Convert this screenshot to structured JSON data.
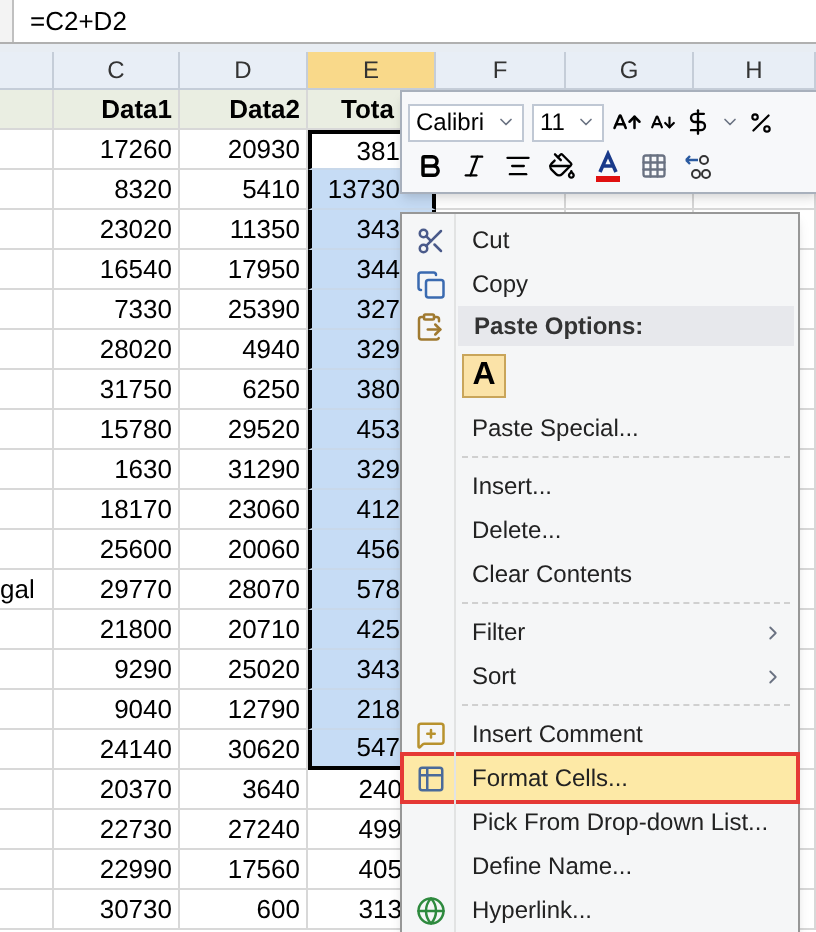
{
  "formula_bar": {
    "value": "=C2+D2"
  },
  "columns": [
    {
      "label": "C",
      "selected": false
    },
    {
      "label": "D",
      "selected": false
    },
    {
      "label": "E",
      "selected": true
    },
    {
      "label": "F",
      "selected": false
    },
    {
      "label": "G",
      "selected": false
    },
    {
      "label": "H",
      "selected": false
    }
  ],
  "header_row": {
    "column_c": "Data1",
    "column_d": "Data2",
    "column_e": "Tota"
  },
  "rows": [
    {
      "column_c": "17260",
      "column_d": "20930",
      "column_e": "381",
      "selected": true,
      "active": true
    },
    {
      "column_c": "8320",
      "column_d": "5410",
      "column_e": "13730",
      "selected": true
    },
    {
      "column_c": "23020",
      "column_d": "11350",
      "column_e": "343",
      "selected": true
    },
    {
      "column_c": "16540",
      "column_d": "17950",
      "column_e": "344",
      "selected": true
    },
    {
      "column_c": "7330",
      "column_d": "25390",
      "column_e": "327",
      "selected": true
    },
    {
      "column_c": "28020",
      "column_d": "4940",
      "column_e": "329",
      "selected": true
    },
    {
      "column_c": "31750",
      "column_d": "6250",
      "column_e": "380",
      "selected": true
    },
    {
      "column_c": "15780",
      "column_d": "29520",
      "column_e": "453",
      "selected": true
    },
    {
      "column_c": "1630",
      "column_d": "31290",
      "column_e": "329",
      "selected": true
    },
    {
      "column_c": "18170",
      "column_d": "23060",
      "column_e": "412",
      "selected": true
    },
    {
      "column_c": "25600",
      "column_d": "20060",
      "column_e": "456",
      "selected": true
    },
    {
      "column_b": "gal",
      "column_c": "29770",
      "column_d": "28070",
      "column_e": "578",
      "selected": true
    },
    {
      "column_c": "21800",
      "column_d": "20710",
      "column_e": "425",
      "selected": true
    },
    {
      "column_c": "9290",
      "column_d": "25020",
      "column_e": "343",
      "selected": true
    },
    {
      "column_c": "9040",
      "column_d": "12790",
      "column_e": "218",
      "selected": true
    },
    {
      "column_c": "24140",
      "column_d": "30620",
      "column_e": "547",
      "selected": true
    },
    {
      "column_c": "20370",
      "column_d": "3640",
      "column_e": "240",
      "selected": false
    },
    {
      "column_c": "22730",
      "column_d": "27240",
      "column_e": "499",
      "selected": false
    },
    {
      "column_c": "22990",
      "column_d": "17560",
      "column_e": "405",
      "selected": false
    },
    {
      "column_c": "30730",
      "column_d": "600",
      "column_e": "313",
      "selected": false
    }
  ],
  "mini_toolbar": {
    "font": "Calibri",
    "size": "11"
  },
  "context_menu": [
    {
      "kind": "item",
      "label": "Cut",
      "submenu": false,
      "selected": false
    },
    {
      "kind": "item",
      "label": "Copy",
      "submenu": false,
      "selected": false
    },
    {
      "kind": "header",
      "label": "Paste Options:"
    },
    {
      "kind": "paste_button",
      "label": "A"
    },
    {
      "kind": "item",
      "label": "Paste Special...",
      "submenu": false,
      "selected": false
    },
    {
      "kind": "separator"
    },
    {
      "kind": "item",
      "label": "Insert...",
      "submenu": false,
      "selected": false
    },
    {
      "kind": "item",
      "label": "Delete...",
      "submenu": false,
      "selected": false
    },
    {
      "kind": "item",
      "label": "Clear Contents",
      "submenu": false,
      "selected": false
    },
    {
      "kind": "separator"
    },
    {
      "kind": "item",
      "label": "Filter",
      "submenu": true,
      "selected": false
    },
    {
      "kind": "item",
      "label": "Sort",
      "submenu": true,
      "selected": false
    },
    {
      "kind": "separator"
    },
    {
      "kind": "item",
      "label": "Insert Comment",
      "submenu": false,
      "selected": false
    },
    {
      "kind": "item",
      "label": "Format Cells...",
      "submenu": false,
      "selected": true
    },
    {
      "kind": "item",
      "label": "Pick From Drop-down List...",
      "submenu": false,
      "selected": false
    },
    {
      "kind": "item",
      "label": "Define Name...",
      "submenu": false,
      "selected": false
    },
    {
      "kind": "item",
      "label": "Hyperlink...",
      "submenu": false,
      "selected": false
    }
  ]
}
